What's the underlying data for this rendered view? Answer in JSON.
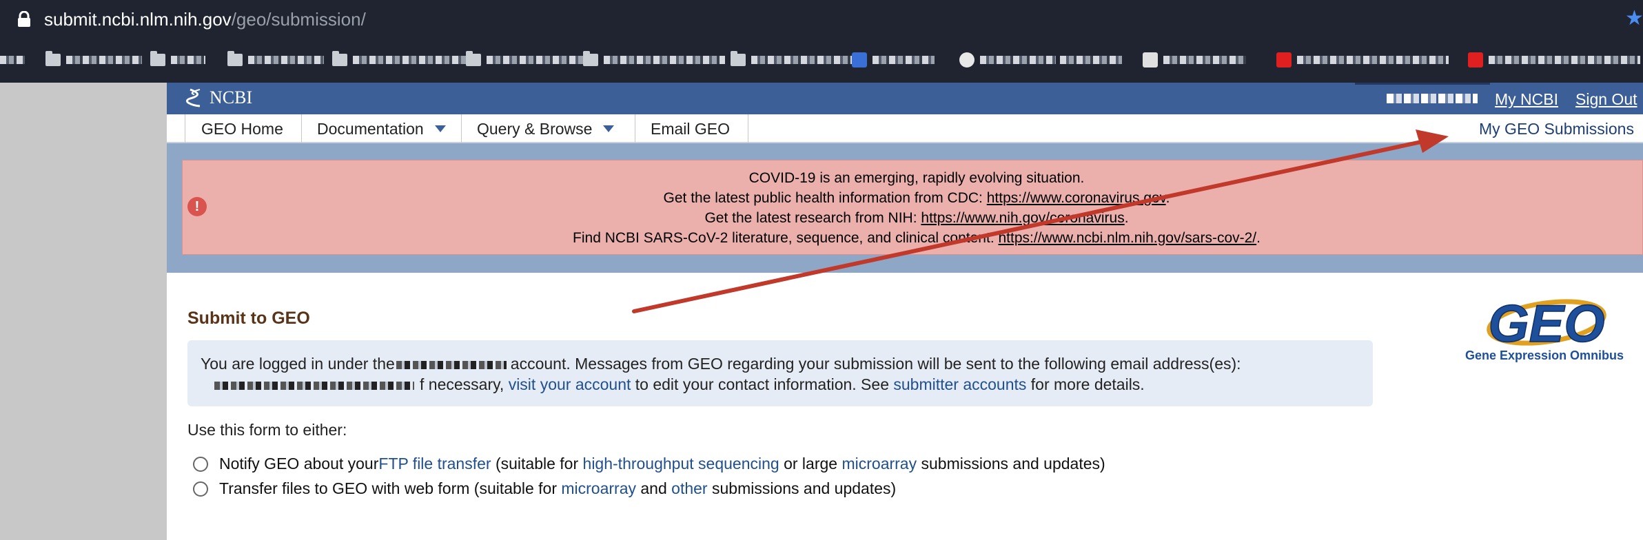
{
  "browser": {
    "url_host": "submit.ncbi.nlm.nih.gov",
    "url_path": "/geo/submission/"
  },
  "header": {
    "logo_text": "NCBI",
    "my_ncbi": "My NCBI",
    "sign_out": "Sign Out"
  },
  "nav": {
    "tabs": [
      {
        "label": "GEO Home"
      },
      {
        "label": "Documentation"
      },
      {
        "label": "Query & Browse"
      },
      {
        "label": "Email GEO"
      }
    ],
    "my_submissions": "My GEO Submissions"
  },
  "alert": {
    "line1": "COVID-19 is an emerging, rapidly evolving situation.",
    "line2_text": "Get the latest public health information from CDC: ",
    "line2_link": "https://www.coronavirus.gov",
    "line2_end": ".",
    "line3_text": "Get the latest research from NIH: ",
    "line3_link": "https://www.nih.gov/coronavirus",
    "line3_end": ".",
    "line4_text": "Find NCBI SARS-CoV-2 literature, sequence, and clinical content: ",
    "line4_link": "https://www.ncbi.nlm.nih.gov/sars-cov-2/",
    "line4_end": "."
  },
  "main": {
    "title": "Submit to GEO",
    "info_prefix": "You are logged in under the",
    "info_suffix": "account. Messages from GEO regarding your submission will be sent to the following email address(es):",
    "info2_prefix": "f necessary, ",
    "visit_account": "visit your account",
    "info2_mid": " to edit your contact information. See ",
    "submitter_accounts": "submitter accounts",
    "info2_end": " for more details.",
    "use_form": "Use this form to either:",
    "option1": {
      "t1": "Notify GEO about your ",
      "l1": "FTP file transfer",
      "t2": " (suitable for ",
      "l2": "high-throughput sequencing",
      "t3": " or large ",
      "l3": "microarray",
      "t4": " submissions and updates)"
    },
    "option2": {
      "t1": "Transfer files to GEO with web form (suitable for ",
      "l1": "microarray",
      "t2": " and ",
      "l2": "other",
      "t3": " submissions and updates)"
    }
  },
  "geo_logo": {
    "text": "GEO",
    "caption": "Gene Expression Omnibus"
  },
  "colors": {
    "ncbi_blue": "#3b5f96",
    "alert_bg": "#ecb0ac",
    "arrow": "#c0392b"
  }
}
